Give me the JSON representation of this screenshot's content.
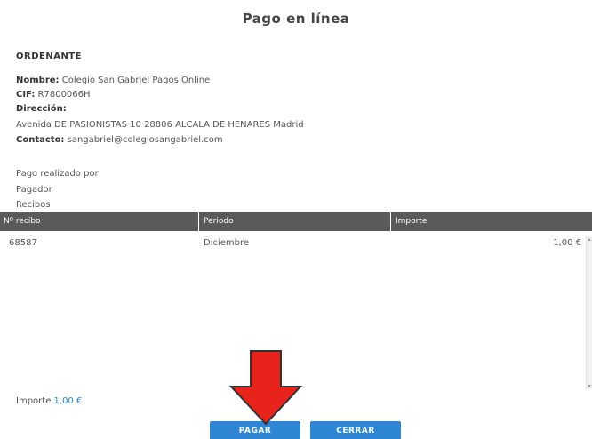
{
  "header": {
    "title": "Pago en línea"
  },
  "ordenante": {
    "heading": "ORDENANTE",
    "nombre_label": "Nombre:",
    "nombre_value": "Colegio San Gabriel Pagos Online",
    "cif_label": "CIF:",
    "cif_value": "R7800066H",
    "direccion_label": "Dirección:",
    "direccion_value": "Avenida DE PASIONISTAS 10 28806 ALCALA DE HENARES Madrid",
    "contacto_label": "Contacto:",
    "contacto_value": "sangabriel@colegiosangabriel.com"
  },
  "pago": {
    "realizado_por": "Pago realizado por",
    "pagador": "Pagador",
    "recibos": "Recibos"
  },
  "table": {
    "columns": [
      "Nº recibo",
      "Periodo",
      "Importe"
    ],
    "rows": [
      {
        "recibo": "68587",
        "periodo": "Diciembre",
        "importe": "1,00 €"
      }
    ]
  },
  "footer": {
    "importe_label": "Importe",
    "importe_value": "1,00 €",
    "pagar_label": "PAGAR",
    "cerrar_label": "CERRAR"
  },
  "colors": {
    "accent": "#2e86d4",
    "table_header": "#5a5a5a",
    "annotation_arrow": "#e8231b"
  },
  "icons": {
    "annotation": "red-down-arrow-icon"
  }
}
